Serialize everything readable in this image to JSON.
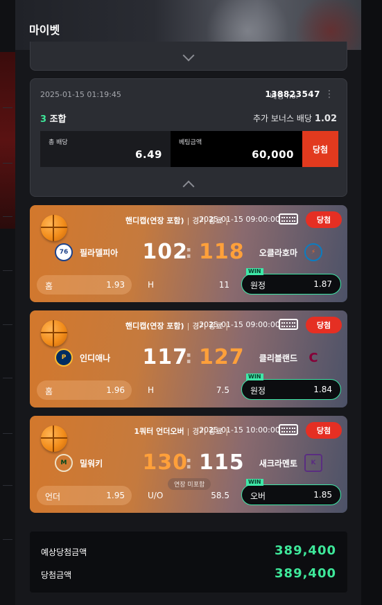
{
  "page": {
    "title": "마이벳"
  },
  "bet": {
    "date": "2025-01-15 01:19:45",
    "bet_no_label": "베팅 no.",
    "bet_no": "138823547",
    "combo_count": "3",
    "combo_label": "조합",
    "bonus_label": "추가 보너스 배당",
    "bonus_value": "1.02",
    "total_odds_label": "총 배당",
    "total_odds": "6.49",
    "amount_label": "베팅금액",
    "amount": "60,000",
    "result_label": "당첨"
  },
  "games": [
    {
      "market": "핸디캡(연장 포함)",
      "status": "경기 종료",
      "datetime": "2025-01-15 09:00:00",
      "result": "당첨",
      "home_team": "필라델피아",
      "away_team": "오클라호마",
      "home_logo": "76ers-logo-icon",
      "away_logo": "thunder-logo-icon",
      "home_score": "102",
      "away_score": "118",
      "home_pick": "홈",
      "home_odds": "1.93",
      "line_label": "H",
      "line_value": "11",
      "away_pick": "원정",
      "away_odds": "1.87",
      "win_tag": "WIN",
      "extra": ""
    },
    {
      "market": "핸디캡(연장 포함)",
      "status": "경기 종료",
      "datetime": "2025-01-15 09:00:00",
      "result": "당첨",
      "home_team": "인디애나",
      "away_team": "클리블랜드",
      "home_logo": "pacers-logo-icon",
      "away_logo": "cavaliers-logo-icon",
      "home_score": "117",
      "away_score": "127",
      "home_pick": "홈",
      "home_odds": "1.96",
      "line_label": "H",
      "line_value": "7.5",
      "away_pick": "원정",
      "away_odds": "1.84",
      "win_tag": "WIN",
      "extra": ""
    },
    {
      "market": "1쿼터 언더오버",
      "status": "경기 종료",
      "datetime": "2025-01-15 10:00:00",
      "result": "당첨",
      "home_team": "밀워키",
      "away_team": "새크라멘토",
      "home_logo": "bucks-logo-icon",
      "away_logo": "kings-logo-icon",
      "home_score": "130",
      "away_score": "115",
      "home_pick": "언더",
      "home_odds": "1.95",
      "line_label": "U/O",
      "line_value": "58.5",
      "away_pick": "오버",
      "away_odds": "1.85",
      "win_tag": "WIN",
      "extra": "연장 미포함"
    }
  ],
  "summary": {
    "expected_label": "예상당첨금액",
    "expected_value": "389,400",
    "won_label": "당첨금액",
    "won_value": "389,400"
  },
  "colors": {
    "accent_green": "#3ee89a",
    "win_red": "#e52f23",
    "score_orange": "#ffa03a"
  }
}
